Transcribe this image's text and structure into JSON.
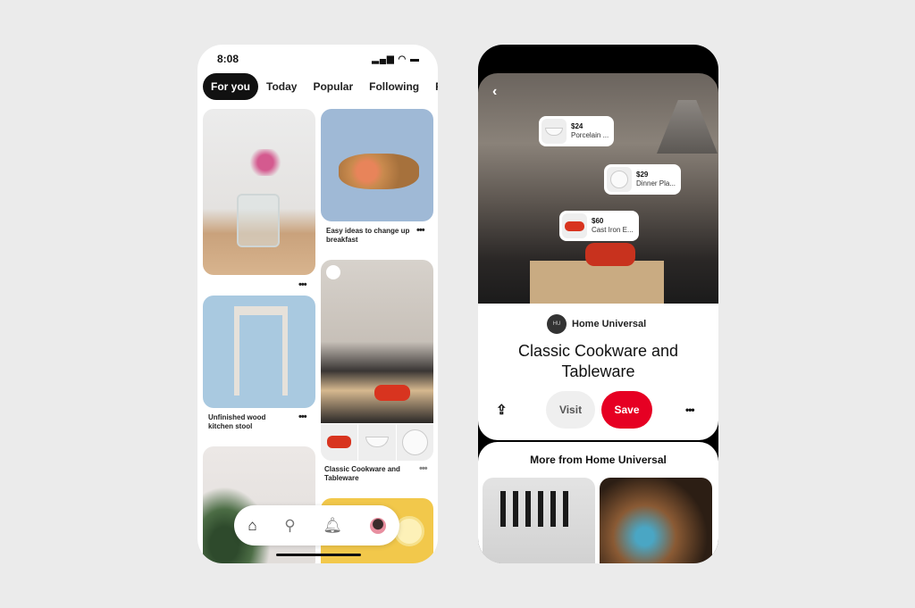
{
  "left_phone": {
    "status": {
      "time": "8:08",
      "signal_icon": "signal-icon",
      "wifi_icon": "wifi-icon",
      "battery_icon": "battery-icon"
    },
    "tabs": [
      {
        "label": "For you",
        "active": true
      },
      {
        "label": "Today"
      },
      {
        "label": "Popular"
      },
      {
        "label": "Following"
      },
      {
        "label": "Re"
      }
    ],
    "pins": [
      {
        "caption": ""
      },
      {
        "caption": "Easy ideas to change up breakfast"
      },
      {
        "caption": "Unfinished wood kitchen stool"
      },
      {
        "caption": "Classic Cookware and Tableware"
      }
    ],
    "more_label": "•••",
    "nav": [
      "home-icon",
      "search-icon",
      "bell-icon",
      "avatar"
    ]
  },
  "right_phone": {
    "product_tags": [
      {
        "price": "$24",
        "name": "Porcelain ..."
      },
      {
        "price": "$29",
        "name": "Dinner Pla..."
      },
      {
        "price": "$60",
        "name": "Cast Iron E..."
      }
    ],
    "brand": {
      "name": "Home Universal",
      "logo": "HU"
    },
    "title": "Classic Cookware and Tableware",
    "buttons": {
      "visit": "Visit",
      "save": "Save",
      "more": "•••"
    },
    "more_from": "More from Home Universal",
    "colors": {
      "save": "#e60023",
      "visit": "#efefef"
    }
  }
}
